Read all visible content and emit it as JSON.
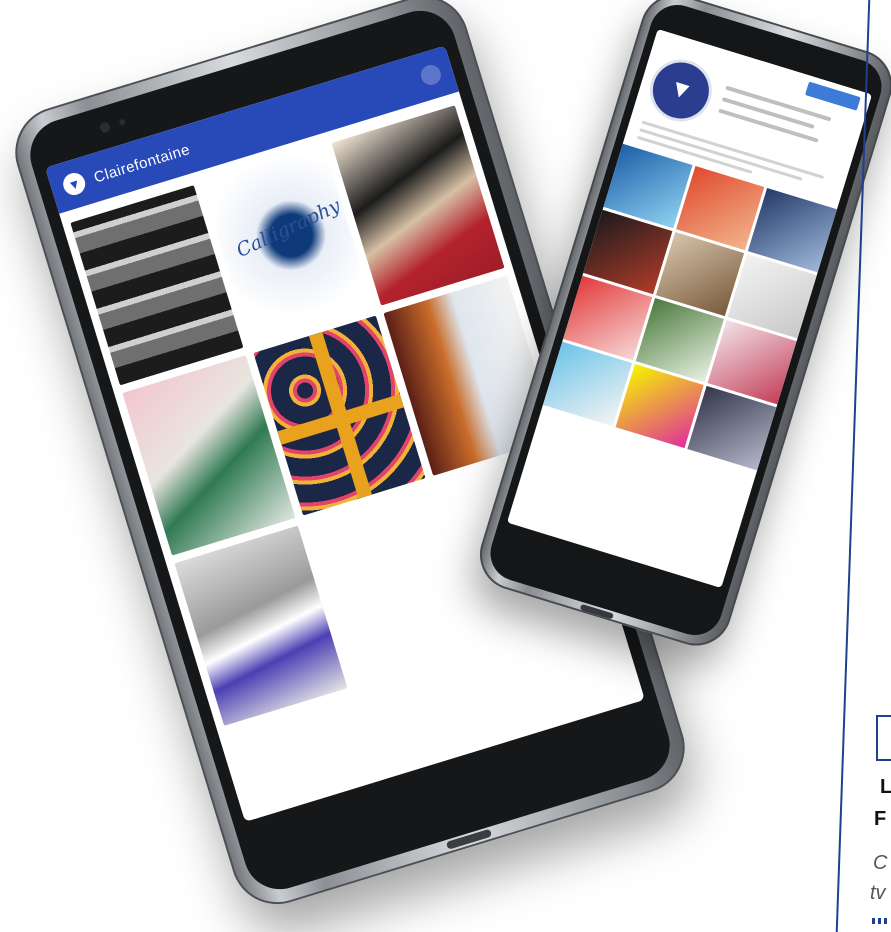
{
  "left_phone": {
    "app_title": "Clairefontaine",
    "logo_glyph": "▼",
    "tile_word": "Calligraphy",
    "tiles": [
      "t1",
      "t2",
      "t3",
      "t4",
      "t5",
      "t6",
      "t7"
    ]
  },
  "right_phone": {
    "avatar_glyph": "▼",
    "feed_count": 12
  },
  "edge": {
    "line1": "L",
    "line2": "F",
    "line3": "C",
    "line4": "tv"
  },
  "colors": {
    "app_bar": "#2849b8",
    "rule": "#1f3f8f"
  }
}
